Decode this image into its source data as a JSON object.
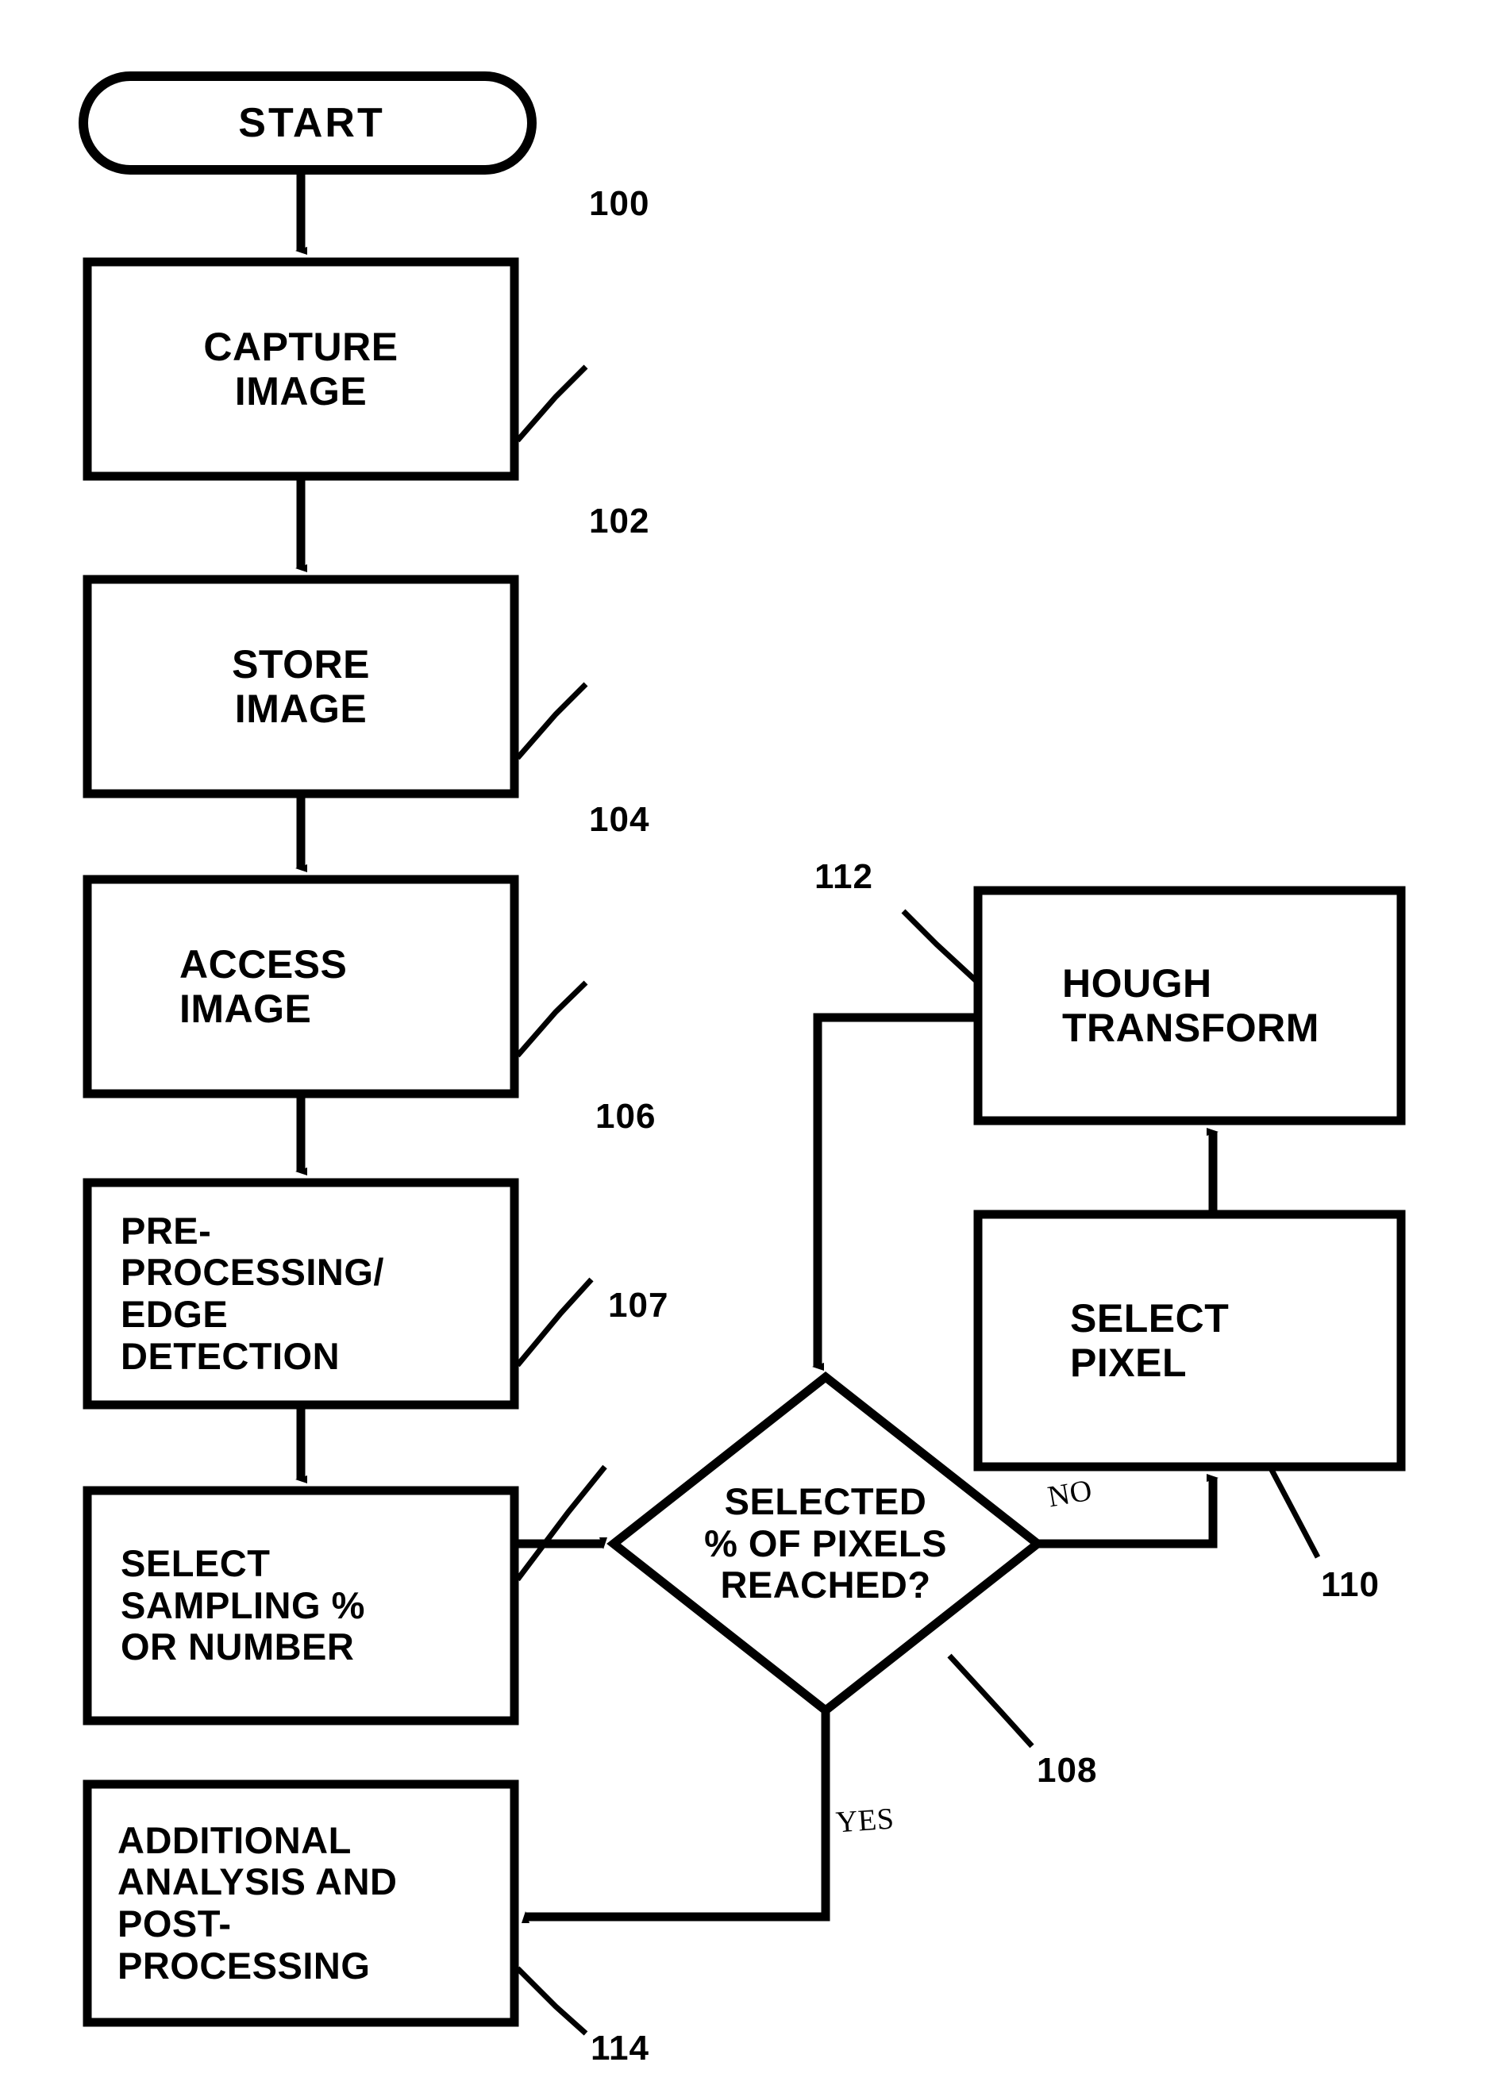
{
  "diagram": {
    "type": "flowchart",
    "title": "Image processing Hough transform flowchart",
    "orientation": "vertical-with-right-loop",
    "line_color": "#000000",
    "background_color": "#ffffff"
  },
  "nodes": {
    "start": {
      "label": "START",
      "shape": "stadium",
      "ref": null
    },
    "capture_image": {
      "label": "CAPTURE\nIMAGE",
      "shape": "rectangle",
      "ref": "100",
      "align": "center"
    },
    "store_image": {
      "label": "STORE\nIMAGE",
      "shape": "rectangle",
      "ref": "102",
      "align": "center"
    },
    "access_image": {
      "label": "ACCESS\nIMAGE",
      "shape": "rectangle",
      "ref": "104",
      "align": "left"
    },
    "preprocessing": {
      "label": "PRE-\nPROCESSING/\nEDGE\nDETECTION",
      "shape": "rectangle",
      "ref": "106",
      "align": "left"
    },
    "select_sampling": {
      "label": "SELECT\nSAMPLING %\nOR NUMBER",
      "shape": "rectangle",
      "ref": "107",
      "align": "left"
    },
    "decision": {
      "label": "SELECTED\n% OF PIXELS\nREACHED?",
      "shape": "diamond",
      "ref": "108",
      "align": "center"
    },
    "select_pixel": {
      "label": "SELECT\nPIXEL",
      "shape": "rectangle",
      "ref": "110",
      "align": "left"
    },
    "hough_transform": {
      "label": "HOUGH\nTRANSFORM",
      "shape": "rectangle",
      "ref": "112",
      "align": "left"
    },
    "post_processing": {
      "label": "ADDITIONAL\nANALYSIS AND\nPOST-\nPROCESSING",
      "shape": "rectangle",
      "ref": "114",
      "align": "left"
    }
  },
  "edges": [
    {
      "from": "start",
      "to": "capture_image",
      "label": ""
    },
    {
      "from": "capture_image",
      "to": "store_image",
      "label": ""
    },
    {
      "from": "store_image",
      "to": "access_image",
      "label": ""
    },
    {
      "from": "access_image",
      "to": "preprocessing",
      "label": ""
    },
    {
      "from": "preprocessing",
      "to": "select_sampling",
      "label": ""
    },
    {
      "from": "select_sampling",
      "to": "decision",
      "label": ""
    },
    {
      "from": "decision",
      "to": "select_pixel",
      "label": "NO"
    },
    {
      "from": "select_pixel",
      "to": "hough_transform",
      "label": ""
    },
    {
      "from": "hough_transform",
      "to": "decision",
      "label": ""
    },
    {
      "from": "decision",
      "to": "post_processing",
      "label": "YES"
    }
  ],
  "branch_labels": {
    "no": "NO",
    "yes": "YES"
  },
  "reference_numerals": [
    "100",
    "102",
    "104",
    "106",
    "107",
    "108",
    "110",
    "112",
    "114"
  ]
}
